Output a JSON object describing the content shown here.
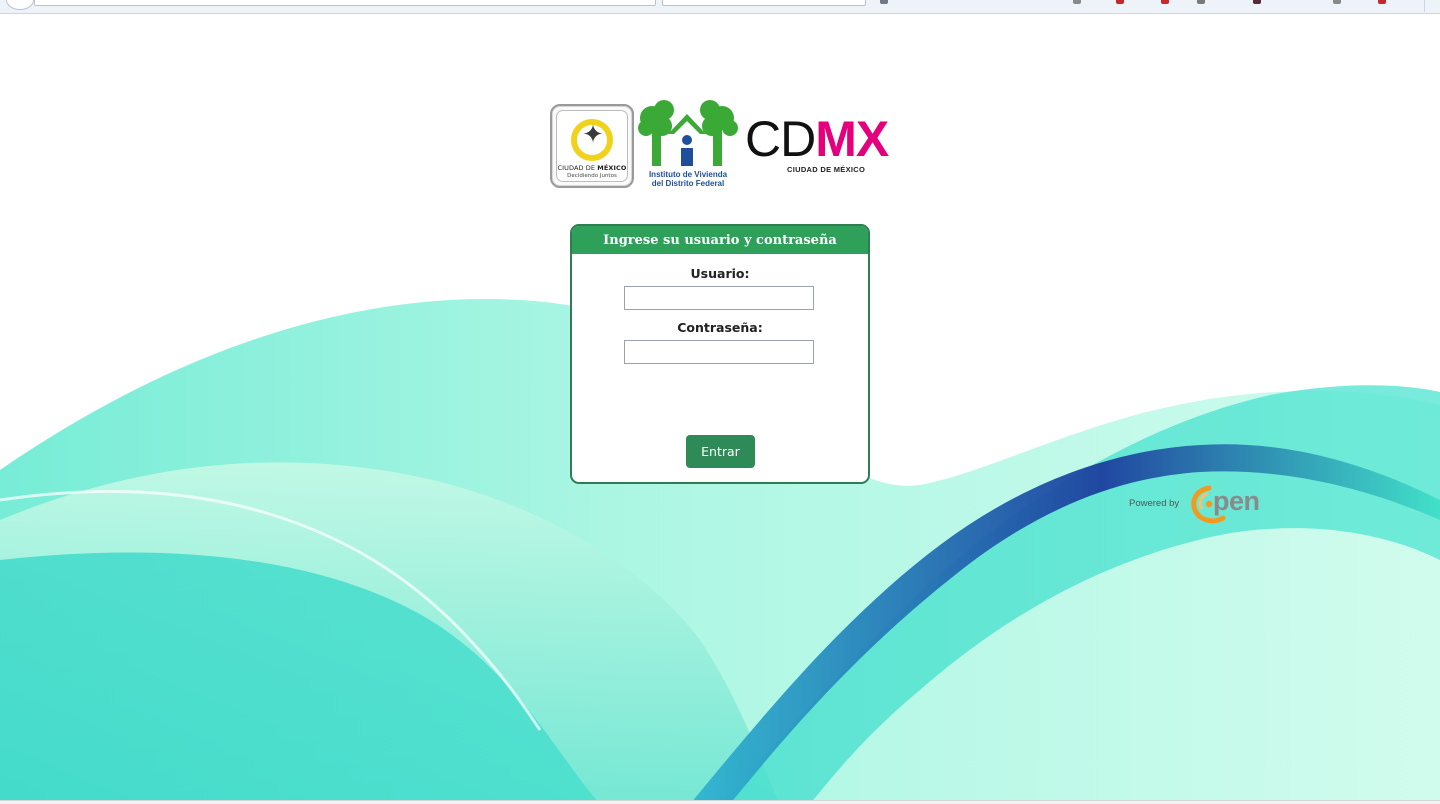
{
  "logos": {
    "seal": {
      "line1_a": "CIUDAD DE ",
      "line1_b": "MÉXICO",
      "line2": "Decidiendo Juntos"
    },
    "invi": {
      "line1": "Instituto de Vivienda",
      "line2": "del Distrito Federal"
    },
    "cdmx": {
      "cd": "CD",
      "mx": "MX",
      "subtitle": "CIUDAD DE MÉXICO"
    }
  },
  "login": {
    "title": "Ingrese su usuario y contraseña",
    "username_label": "Usuario:",
    "username_value": "",
    "password_label": "Contraseña:",
    "password_value": "",
    "submit_label": "Entrar"
  },
  "footer": {
    "powered_label": "Powered by",
    "brand": "pen"
  },
  "colors": {
    "header_green": "#2ea05a",
    "border_green": "#2e7d55",
    "button_green": "#2e8b57",
    "cdmx_magenta": "#e4007c",
    "invi_green": "#3aa935",
    "invi_blue": "#1f4e9a",
    "wave_aqua": "#3fe0c8",
    "wave_navy": "#1d3f9e",
    "open_orange": "#f39a1e",
    "open_gray": "#8a8a8a"
  }
}
